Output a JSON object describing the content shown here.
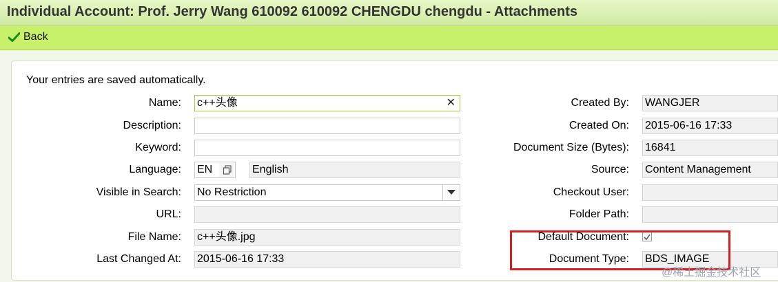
{
  "header": {
    "title": "Individual Account: Prof. Jerry Wang 610092 610092 CHENGDU chengdu - Attachments"
  },
  "toolbar": {
    "back_label": "Back"
  },
  "form": {
    "info": "Your entries are saved automatically.",
    "left": {
      "name": {
        "label": "Name:",
        "value": "c++头像"
      },
      "description": {
        "label": "Description:",
        "value": ""
      },
      "keyword": {
        "label": "Keyword:",
        "value": ""
      },
      "language": {
        "label": "Language:",
        "code": "EN",
        "text": "English"
      },
      "visible_in_search": {
        "label": "Visible in Search:",
        "value": "No Restriction"
      },
      "url": {
        "label": "URL:",
        "value": ""
      },
      "file_name": {
        "label": "File Name:",
        "value": "c++头像.jpg"
      },
      "last_changed_at": {
        "label": "Last Changed At:",
        "value": "2015-06-16 17:33"
      }
    },
    "right": {
      "created_by": {
        "label": "Created By:",
        "value": "WANGJER"
      },
      "created_on": {
        "label": "Created On:",
        "value": "2015-06-16 17:33"
      },
      "document_size": {
        "label": "Document Size (Bytes):",
        "value": "16841"
      },
      "source": {
        "label": "Source:",
        "value": "Content Management"
      },
      "checkout_user": {
        "label": "Checkout User:",
        "value": ""
      },
      "folder_path": {
        "label": "Folder Path:",
        "value": ""
      },
      "default_document": {
        "label": "Default Document:",
        "checked": true
      },
      "document_type": {
        "label": "Document Type:",
        "value": "BDS_IMAGE"
      }
    }
  },
  "watermark": "@稀土掘金技术社区",
  "colors": {
    "toolbar": "#c8f06a",
    "highlight": "#d21f1f",
    "focus_border": "#9ccc3a"
  },
  "icons": {
    "back": "check-icon",
    "clear": "close-icon",
    "copy": "copy-icon",
    "dropdown": "triangle-down-icon"
  }
}
